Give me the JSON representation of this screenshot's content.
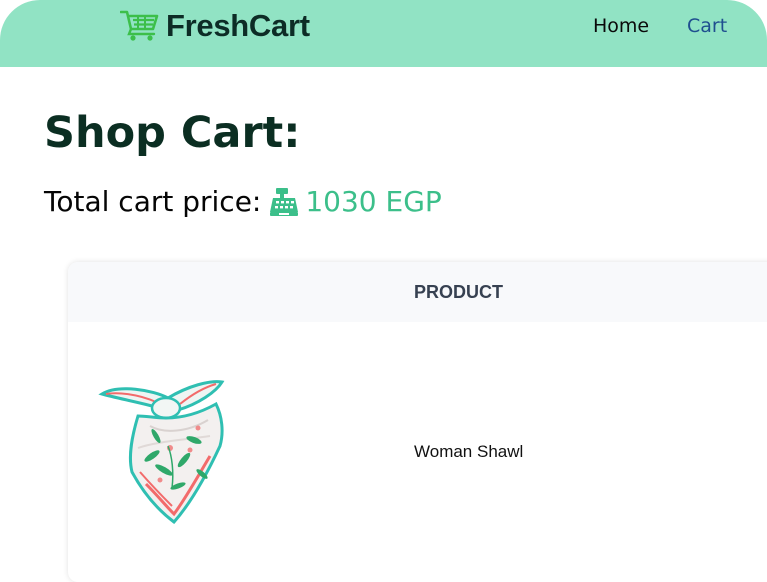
{
  "navbar": {
    "brand": "FreshCart",
    "brand_icon": "shopping-cart-icon",
    "links": [
      {
        "label": "Home"
      },
      {
        "label": "Cart",
        "active": true
      }
    ],
    "colors": {
      "background": "#91e3c4",
      "active_link": "#1f4f8f"
    }
  },
  "page": {
    "title": "Shop Cart:",
    "total_label": "Total cart price:",
    "total_icon": "cash-register-icon",
    "total_value": "1030 EGP",
    "accent_color": "#3cbf8a"
  },
  "table": {
    "headers": [
      "PRODUCT"
    ],
    "rows": [
      {
        "image": "scarf-image",
        "product": "Woman Shawl"
      }
    ]
  }
}
